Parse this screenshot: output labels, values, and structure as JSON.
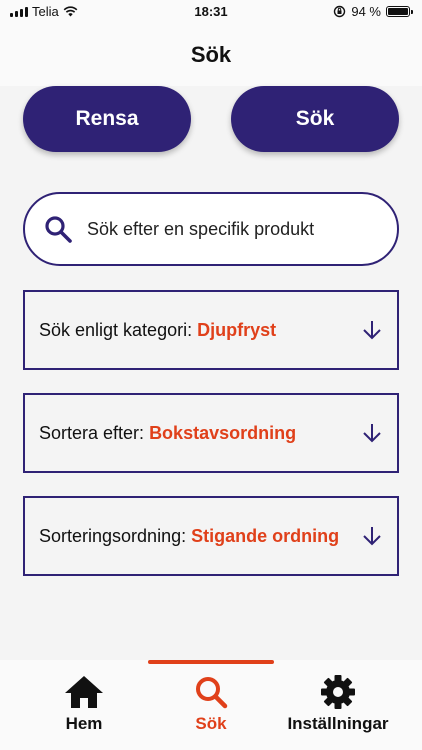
{
  "status_bar": {
    "carrier": "Telia",
    "time": "18:31",
    "battery_percent": "94 %"
  },
  "header": {
    "title": "Sök"
  },
  "actions": {
    "clear_label": "Rensa",
    "search_label": "Sök"
  },
  "search": {
    "placeholder": "Sök efter en specifik produkt"
  },
  "filters": [
    {
      "label": "Sök enligt kategori:",
      "value": "Djupfryst"
    },
    {
      "label": "Sortera efter:",
      "value": "Bokstavsordning"
    },
    {
      "label": "Sorteringsordning:",
      "value": "Stigande ordning"
    }
  ],
  "tab_bar": {
    "tabs": [
      {
        "label": "Hem",
        "icon": "home-icon"
      },
      {
        "label": "Sök",
        "icon": "search-icon",
        "active": true
      },
      {
        "label": "Inställningar",
        "icon": "gear-icon"
      }
    ]
  },
  "colors": {
    "primary": "#2f2275",
    "accent": "#e0401a",
    "background": "#f4f4f4"
  }
}
